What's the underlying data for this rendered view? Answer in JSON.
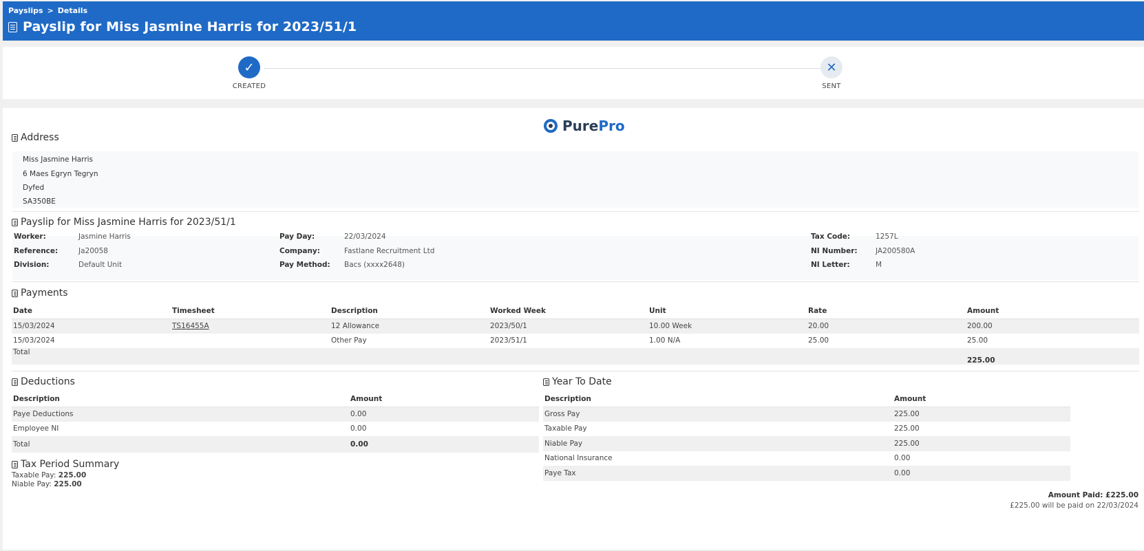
{
  "breadcrumb": {
    "root": "Payslips",
    "separator": ">",
    "current": "Details"
  },
  "page_title": "Payslip for Miss Jasmine Harris for 2023/51/1",
  "steps": [
    {
      "label": "CREATED",
      "state": "done"
    },
    {
      "label": "SENT",
      "state": "pending"
    }
  ],
  "logo": {
    "part1": "Pure",
    "part2": "Pro"
  },
  "address": {
    "title": "Address",
    "lines": [
      "Miss Jasmine Harris",
      "6 Maes Egryn Tegryn",
      "Dyfed",
      "SA350BE"
    ]
  },
  "payslip": {
    "title": "Payslip for Miss Jasmine Harris for 2023/51/1",
    "fields": {
      "worker": {
        "label": "Worker:",
        "value": "Jasmine Harris"
      },
      "reference": {
        "label": "Reference:",
        "value": "Ja20058"
      },
      "division": {
        "label": "Division:",
        "value": "Default Unit"
      },
      "pay_day": {
        "label": "Pay Day:",
        "value": "22/03/2024"
      },
      "company": {
        "label": "Company:",
        "value": "Fastlane Recruitment Ltd"
      },
      "pay_method": {
        "label": "Pay Method:",
        "value": "Bacs (xxxx2648)"
      },
      "tax_code": {
        "label": "Tax Code:",
        "value": "1257L"
      },
      "ni_number": {
        "label": "NI Number:",
        "value": "JA200580A"
      },
      "ni_letter": {
        "label": "NI Letter:",
        "value": "M"
      }
    }
  },
  "payments": {
    "title": "Payments",
    "headers": [
      "Date",
      "Timesheet",
      "Description",
      "Worked Week",
      "Unit",
      "Rate",
      "Amount"
    ],
    "rows": [
      [
        "15/03/2024",
        "TS16455A",
        "12 Allowance",
        "2023/50/1",
        "10.00 Week",
        "20.00",
        "200.00"
      ],
      [
        "15/03/2024",
        "",
        "Other Pay",
        "2023/51/1",
        "1.00 N/A",
        "25.00",
        "25.00"
      ]
    ],
    "total_label": "Total",
    "total": "225.00"
  },
  "deductions": {
    "title": "Deductions",
    "headers": [
      "Description",
      "Amount"
    ],
    "rows": [
      [
        "Paye Deductions",
        "0.00"
      ],
      [
        "Employee NI",
        "0.00"
      ]
    ],
    "total_label": "Total",
    "total": "0.00"
  },
  "ytd": {
    "title": "Year To Date",
    "headers": [
      "Description",
      "Amount"
    ],
    "rows": [
      [
        "Gross Pay",
        "225.00"
      ],
      [
        "Taxable Pay",
        "225.00"
      ],
      [
        "Niable Pay",
        "225.00"
      ],
      [
        "National Insurance",
        "0.00"
      ],
      [
        "Paye Tax",
        "0.00"
      ]
    ]
  },
  "tax_summary": {
    "title": "Tax Period Summary",
    "taxable_label": "Taxable Pay:",
    "taxable_value": "225.00",
    "niable_label": "Niable Pay:",
    "niable_value": "225.00"
  },
  "amount_paid": {
    "label": "Amount Paid:",
    "value": "£225.00",
    "note": "£225.00 will be paid on 22/03/2024"
  },
  "colors": {
    "primary": "#1f6ac6",
    "stripe": "#f0f0f0"
  },
  "icons": {
    "section": "document-icon",
    "done": "check-icon",
    "pending": "cross-icon"
  }
}
